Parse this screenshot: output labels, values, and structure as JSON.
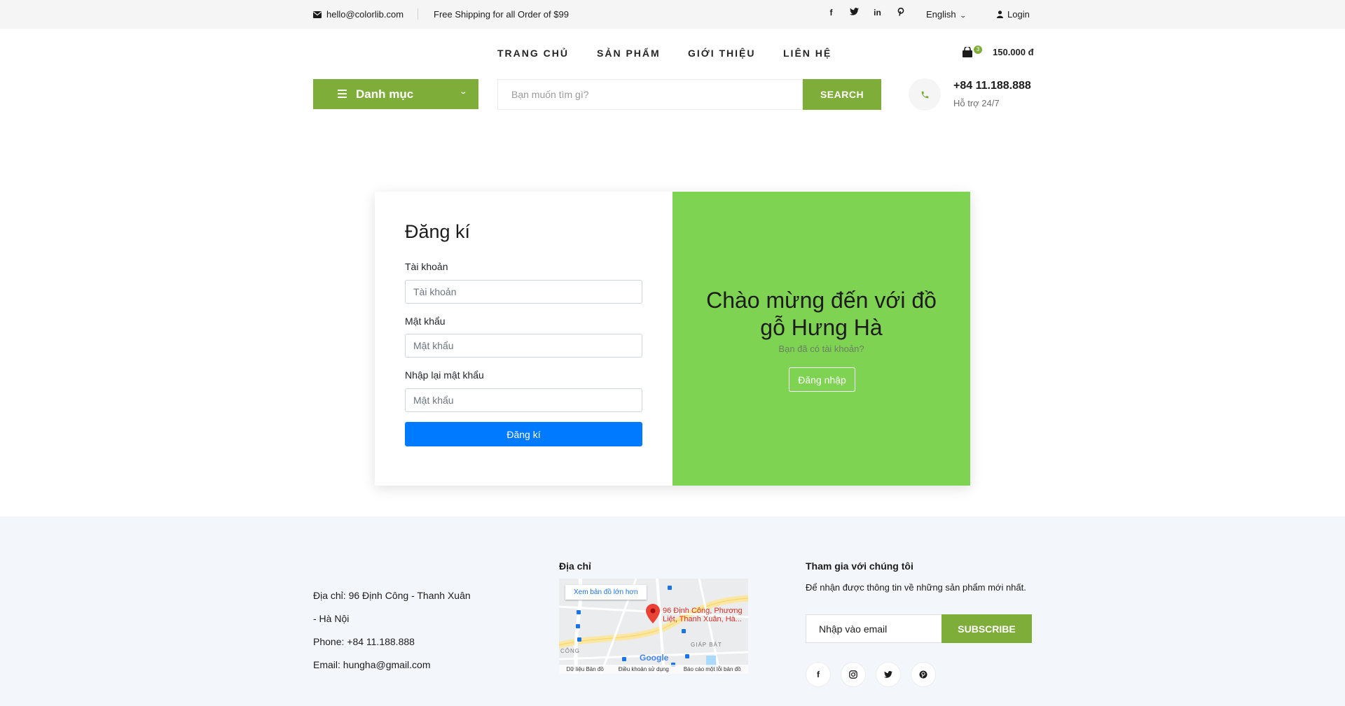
{
  "topbar": {
    "email": "hello@colorlib.com",
    "shipping": "Free Shipping for all Order of $99",
    "social": [
      "facebook-icon",
      "twitter-icon",
      "linkedin-icon",
      "pinterest-icon"
    ],
    "language": "English",
    "login": "Login"
  },
  "nav": {
    "items": [
      "TRANG CHỦ",
      "SẢN PHẨM",
      "GIỚI THIỆU",
      "LIÊN HỆ"
    ],
    "cart_count": "3",
    "cart_total": "150.000 đ"
  },
  "hero": {
    "category_label": "Danh mục",
    "search_placeholder": "Bạn muốn tìm gì?",
    "search_button": "SEARCH",
    "phone": "+84 11.188.888",
    "phone_note": "Hỗ trợ 24/7"
  },
  "signup": {
    "title": "Đăng kí",
    "username_label": "Tài khoản",
    "username_placeholder": "Tài khoản",
    "password_label": "Mật khẩu",
    "password_placeholder": "Mật khẩu",
    "confirm_label": "Nhập lại mật khẩu",
    "confirm_placeholder": "Mật khẩu",
    "submit": "Đăng kí",
    "welcome_title": "Chào mừng đến với đồ gỗ Hưng Hà",
    "welcome_sub": "Bạn đã có tài khoản?",
    "login_button": "Đăng nhập"
  },
  "footer": {
    "address_line1": "Địa chỉ: 96 Định Công - Thanh Xuân",
    "address_line2": "- Hà Nội",
    "phone": "Phone: +84 11.188.888",
    "email": "Email: hungha@gmail.com",
    "map_heading": "Địa chỉ",
    "map_link": "Xem bản đồ lớn hơn",
    "map_address": "96 Định Công, Phương Liệt, Thanh Xuân, Hà...",
    "map_area_label": "GIÁP BÁT",
    "map_area_label2": "CÔNG",
    "map_data": "Dữ liệu Bản đồ",
    "map_terms": "Điều khoản sử dụng",
    "map_report": "Báo cáo một lỗi bản đồ",
    "map_google": "Google",
    "newsletter_heading": "Tham gia với chúng tôi",
    "newsletter_desc": "Để nhận được thông tin về những sản phẩm mới nhất.",
    "newsletter_placeholder": "Nhập vào email",
    "subscribe": "SUBSCRIBE",
    "social": [
      "facebook-icon",
      "instagram-icon",
      "twitter-icon",
      "pinterest-icon"
    ]
  },
  "colors": {
    "brand_green": "#7fad39",
    "welcome_green": "#7ed352",
    "primary_blue": "#007bff",
    "footer_bg": "#f3f6fa"
  }
}
